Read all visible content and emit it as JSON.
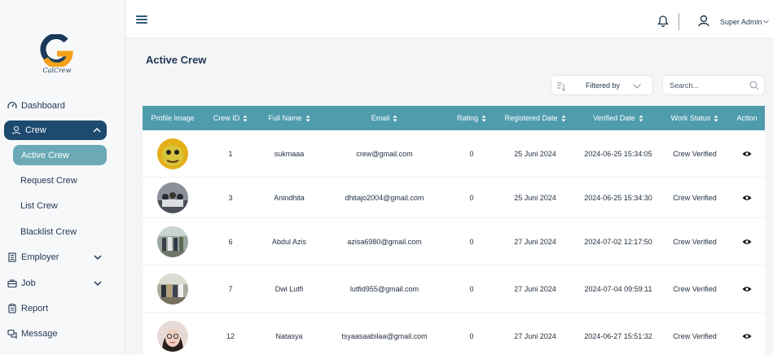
{
  "sidebar": {
    "logo_text": "CalCrew",
    "dashboard": "Dashboard",
    "crew": "Crew",
    "crew_sub": [
      "Active Crew",
      "Request Crew",
      "List Crew",
      "Blacklist Crew"
    ],
    "employer": "Employer",
    "job": "Job",
    "report": "Report",
    "message": "Message"
  },
  "topbar": {
    "user_name": "Super Admin"
  },
  "page": {
    "title": "Active Crew",
    "filter_label": "Filtered by",
    "search_placeholder": "Search..."
  },
  "table": {
    "headers": [
      "Profile Image",
      "Crew ID",
      "Full Name",
      "Email",
      "Rating",
      "Registered Date",
      "Verified Date",
      "Work Status",
      "Action"
    ],
    "rows": [
      {
        "id": "1",
        "name": "sukmaaa",
        "email": "crew@gmail.com",
        "rating": "0",
        "registered": "25 Juni 2024",
        "verified": "2024-06-25 15:34:05",
        "status": "Crew Verified"
      },
      {
        "id": "3",
        "name": "Anindhita",
        "email": "dhitajo2004@gmail.com",
        "rating": "0",
        "registered": "25 Juni 2024",
        "verified": "2024-06-25 15:34:30",
        "status": "Crew Verified"
      },
      {
        "id": "6",
        "name": "Abdul Azis",
        "email": "azisa6980@gmail.com",
        "rating": "0",
        "registered": "27 Juni 2024",
        "verified": "2024-07-02 12:17:50",
        "status": "Crew Verified"
      },
      {
        "id": "7",
        "name": "Dwi Lutfi",
        "email": "lutfid955@gmail.com",
        "rating": "0",
        "registered": "27 Juni 2024",
        "verified": "2024-07-04 09:59:11",
        "status": "Crew Verified"
      },
      {
        "id": "12",
        "name": "Natasya",
        "email": "tsyaasaabilaa@gmail.com",
        "rating": "0",
        "registered": "27 Juni 2024",
        "verified": "2024-06-27 15:51:32",
        "status": "Crew Verified"
      }
    ]
  },
  "colors": {
    "primary": "#1d4a6e",
    "accent": "#6aa9b5",
    "table_header": "#4f9cad",
    "logo_orange": "#f4a21a",
    "logo_navy": "#1a3a5c"
  },
  "icons": [
    "menu-icon",
    "bell-icon",
    "user-icon",
    "chevron-down-icon",
    "filter-icon",
    "search-icon",
    "eye-icon",
    "dashboard-icon",
    "person-icon",
    "building-icon",
    "briefcase-icon",
    "report-icon",
    "message-icon",
    "sort-icon"
  ]
}
